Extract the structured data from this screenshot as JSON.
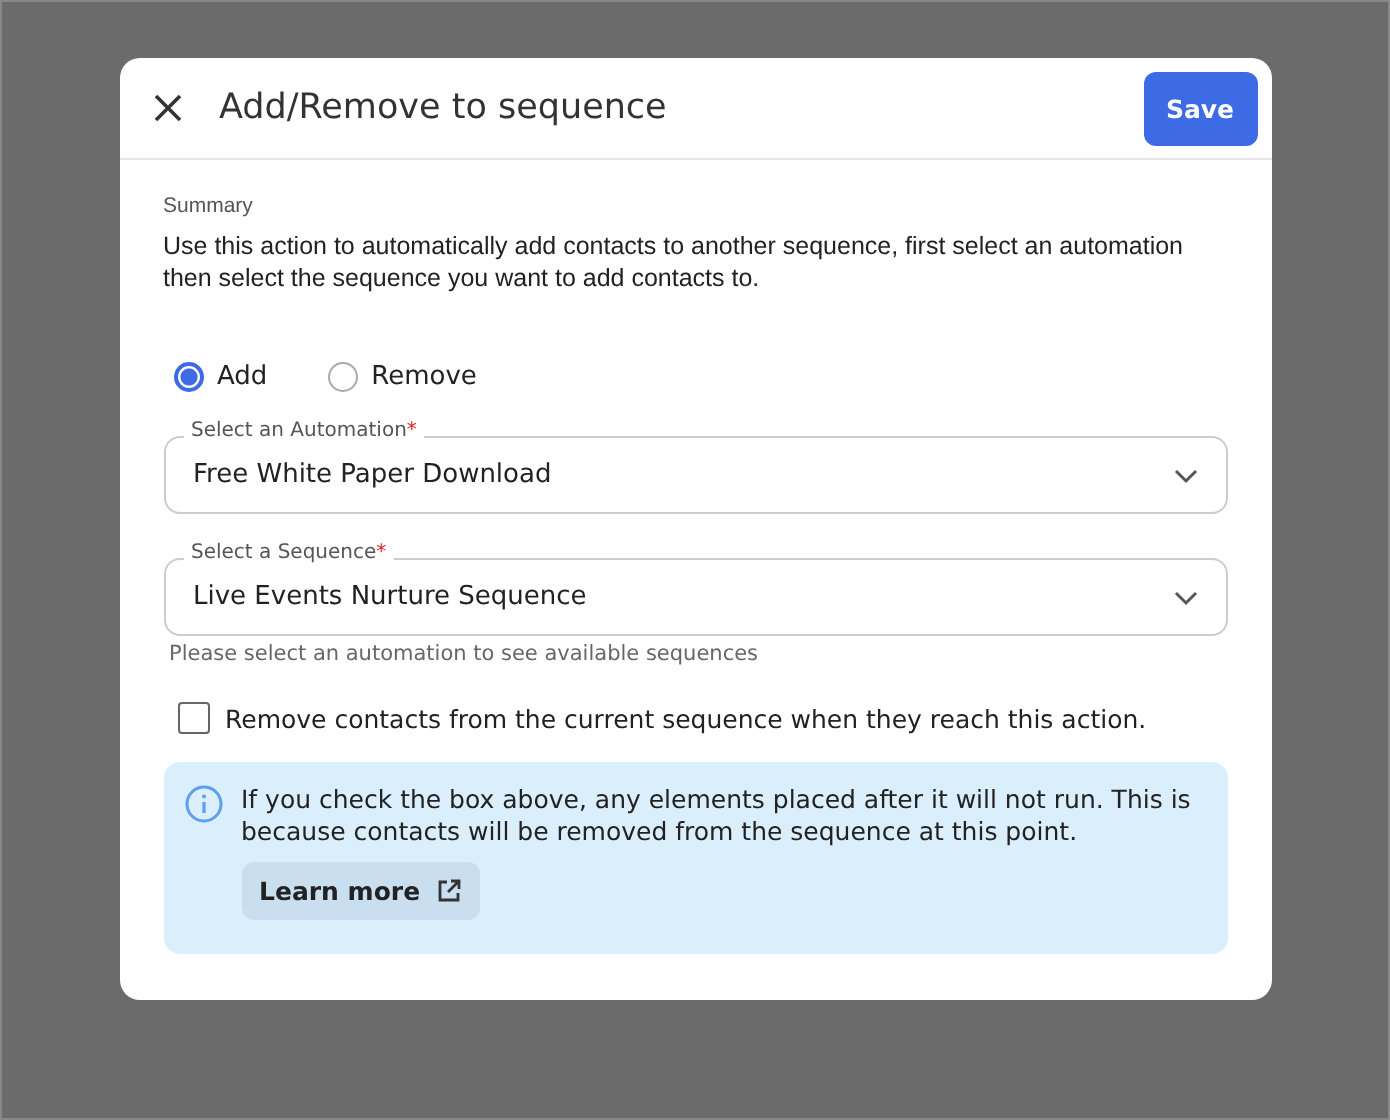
{
  "dialog": {
    "title": "Add/Remove to sequence",
    "save_button": "Save"
  },
  "summary": {
    "label": "Summary",
    "text": "Use this action to automatically add contacts to another sequence, first select an automation then select the sequence you want to add contacts to."
  },
  "mode_options": [
    {
      "label": "Add",
      "selected": true
    },
    {
      "label": "Remove",
      "selected": false
    }
  ],
  "fields": [
    {
      "label": "Select an Automation",
      "required_mark": "*",
      "value": "Free White Paper Download"
    },
    {
      "label": "Select a Sequence",
      "required_mark": "*",
      "value": "Live Events Nurture Sequence",
      "helper": "Please select an automation to see available sequences"
    }
  ],
  "remove_checkbox": {
    "label": "Remove contacts from the current sequence when they reach this action.",
    "checked": false
  },
  "info": {
    "text": "If you check the box above, any elements placed after it will not run. This is because contacts will be removed from the sequence at this point.",
    "link": "Learn more"
  }
}
